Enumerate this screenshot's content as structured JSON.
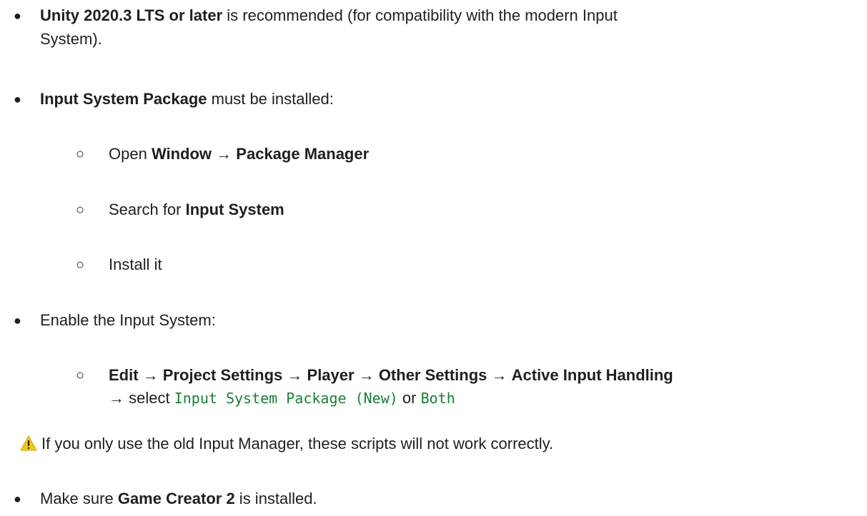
{
  "items": {
    "unity_version": {
      "bold": "Unity 2020.3 LTS or later",
      "rest_line1": " is recommended (for compatibility with the modern Input",
      "rest_line2": "System)."
    },
    "input_package": {
      "bold": "Input System Package",
      "rest": " must be installed:",
      "steps": {
        "open_prefix": "Open ",
        "window": "Window",
        "arrow": " → ",
        "package_manager": "Package Manager",
        "search_prefix": "Search for ",
        "input_system": "Input System",
        "install": "Install it"
      }
    },
    "enable": {
      "text": "Enable the Input System:",
      "edit": "Edit",
      "project_settings": "Project Settings",
      "player": "Player",
      "other_settings": "Other Settings",
      "active_input": "Active Input Handling",
      "arrow": " → ",
      "select_prefix": "→ select ",
      "code_new": "Input System Package (New)",
      "or": " or ",
      "code_both": "Both"
    },
    "warning": {
      "icon": "warning-icon",
      "text": "If you only use the old Input Manager, these scripts will not work correctly."
    },
    "game_creator": {
      "prefix": "Make sure ",
      "bold": "Game Creator 2",
      "suffix": " is installed."
    }
  }
}
